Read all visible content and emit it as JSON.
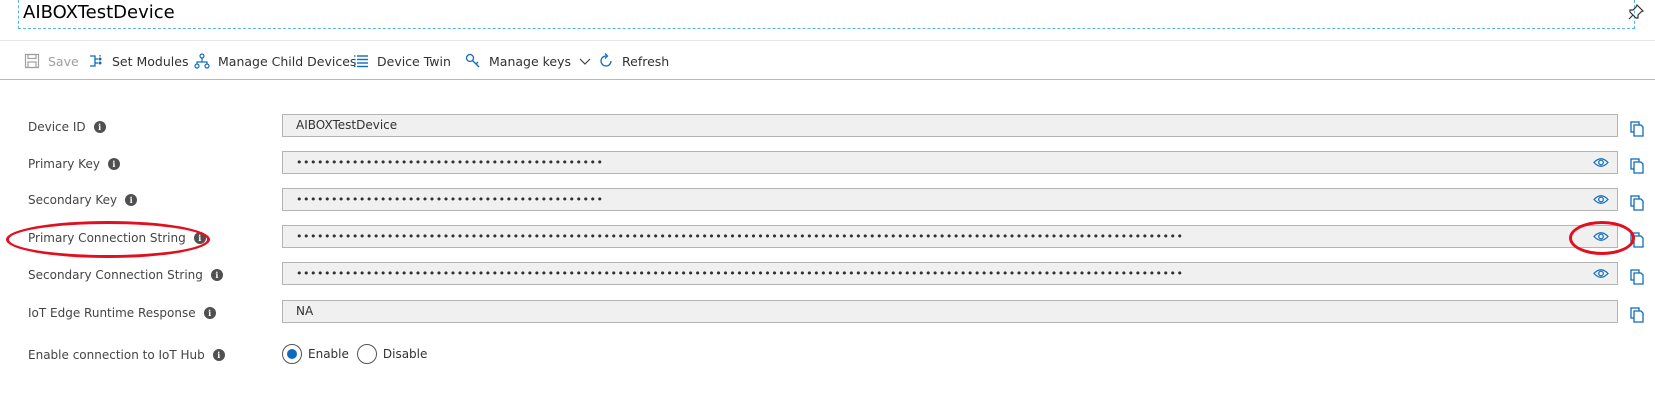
{
  "header": {
    "title": "AIBOXTestDevice"
  },
  "toolbar": {
    "save": "Save",
    "set_modules": "Set Modules",
    "manage_child": "Manage Child Devices",
    "device_twin": "Device Twin",
    "manage_keys": "Manage keys",
    "refresh": "Refresh"
  },
  "fields": {
    "device_id": {
      "label": "Device ID",
      "value": "AIBOXTestDevice"
    },
    "primary_key": {
      "label": "Primary Key",
      "value": "••••••••••••••••••••••••••••••••••••••••••••"
    },
    "secondary_key": {
      "label": "Secondary Key",
      "value": "••••••••••••••••••••••••••••••••••••••••••••"
    },
    "primary_conn": {
      "label": "Primary Connection String",
      "value": "•••••••••••••••••••••••••••••••••••••••••••••••••••••••••••••••••••••••••••••••••••••••••••••••••••••••••••••••••••••••••••••••"
    },
    "secondary_conn": {
      "label": "Secondary Connection String",
      "value": "•••••••••••••••••••••••••••••••••••••••••••••••••••••••••••••••••••••••••••••••••••••••••••••••••••••••••••••••••••••••••••••••"
    },
    "edge_runtime": {
      "label": "IoT Edge Runtime Response",
      "value": "NA"
    }
  },
  "connection": {
    "label": "Enable connection to IoT Hub",
    "enable": "Enable",
    "disable": "Disable",
    "selected": "Enable"
  },
  "colors": {
    "accent": "#0f6cbd",
    "annotation": "#e0101f"
  },
  "icons": [
    "pin-icon",
    "save-icon",
    "set-modules-icon",
    "manage-child-icon",
    "device-twin-icon",
    "manage-keys-icon",
    "chevron-down-icon",
    "refresh-icon",
    "info-icon",
    "eye-icon",
    "copy-icon"
  ]
}
